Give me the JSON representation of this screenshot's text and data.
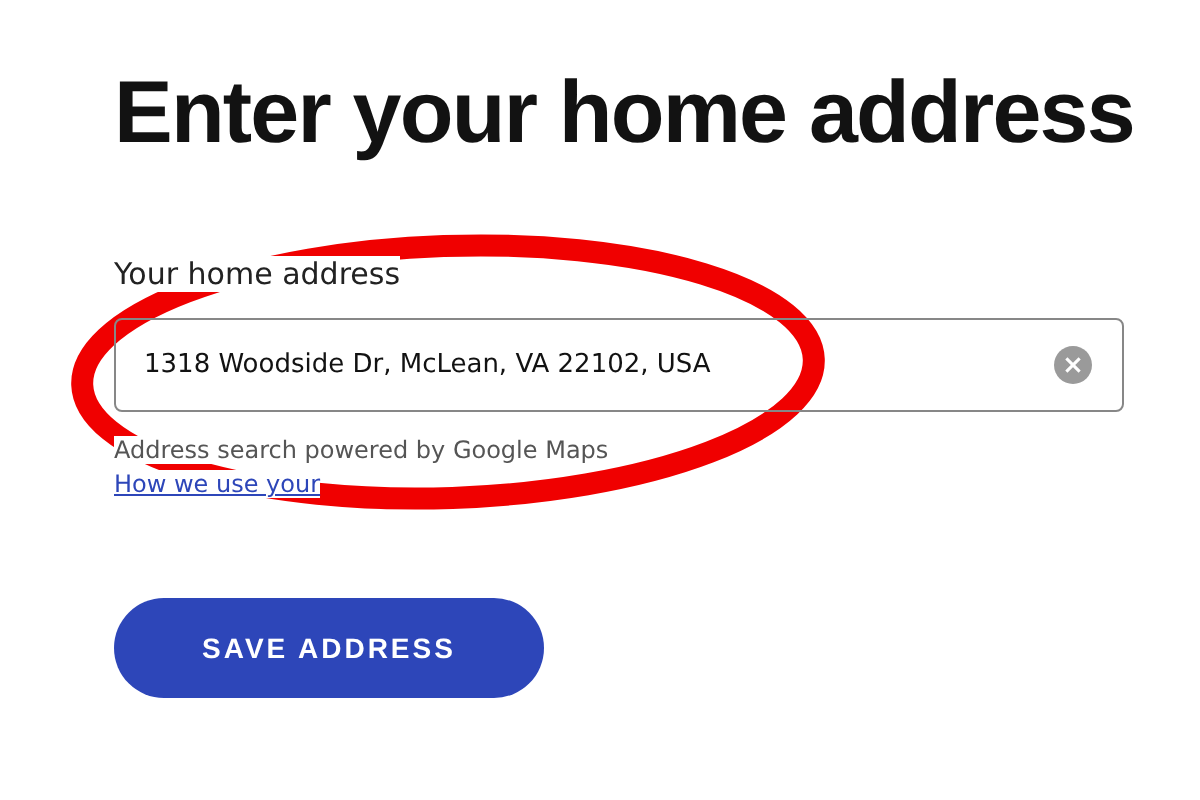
{
  "heading": "Enter your home address",
  "address_field": {
    "label": "Your home address",
    "value": "1318 Woodside Dr, McLean, VA 22102, USA"
  },
  "hint": "Address search powered by Google Maps",
  "link": "How we use your",
  "button": "SAVE ADDRESS"
}
